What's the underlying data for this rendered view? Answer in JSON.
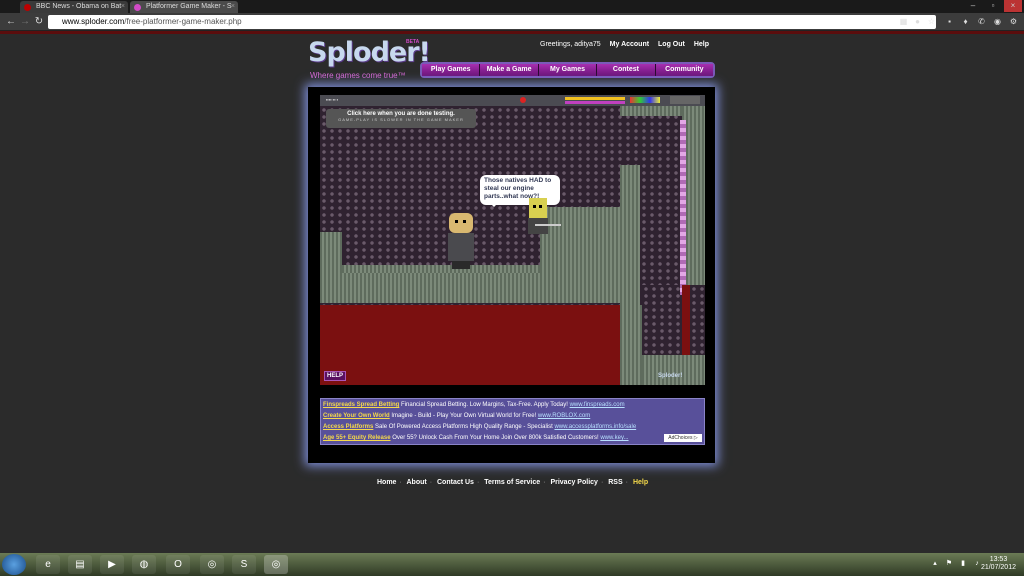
{
  "browser": {
    "tabs": [
      {
        "label": "BBC News - Obama on Bat",
        "active": false
      },
      {
        "label": "Platformer Game Maker - S",
        "active": true
      }
    ],
    "url_host": "www.sploder.com",
    "url_path": "/free-platformer-game-maker.php"
  },
  "header": {
    "logo": "Sploder!",
    "beta": "BETA",
    "tagline": "Where games come true™",
    "greeting": "Greetings, aditya75",
    "links": [
      "My Account",
      "Log Out",
      "Help"
    ]
  },
  "nav": [
    "Play Games",
    "Make a Game",
    "My Games",
    "Contest",
    "Community"
  ],
  "game": {
    "test_title": "Click here when you are done testing.",
    "test_sub": "GAME-PLAY IS SLOWER IN THE GAME MAKER",
    "speech": "Those natives HAD to steal our engine parts..what now?!",
    "help": "HELP",
    "badge": "Sploder!"
  },
  "ads": [
    {
      "title": "Finspreads Spread Betting",
      "text": "Financial Spread Betting. Low Margins, Tax-Free. Apply Today!",
      "url": "www.finspreads.com"
    },
    {
      "title": "Create Your Own World",
      "text": "Imagine - Build - Play Your Own Virtual World for Free!",
      "url": "www.ROBLOX.com"
    },
    {
      "title": "Access Platforms",
      "text": "Sale Of Powered Access Platforms High Quality Range - Specialist",
      "url": "www.accessplatforms.info/sale"
    },
    {
      "title": "Age 55+ Equity Release",
      "text": "Over 55? Unlock Cash From Your Home Join Over 800k Satisfied Customers!",
      "url": "www.key..."
    }
  ],
  "adchoices": "AdChoices ▷",
  "footer": [
    "Home",
    "About",
    "Contact Us",
    "Terms of Service",
    "Privacy Policy",
    "RSS",
    "Help"
  ],
  "taskbar": {
    "time": "13:53",
    "date": "21/07/2012"
  },
  "colors": {
    "accent": "#a82fb0",
    "page_bg": "#2b2b2b",
    "frame_glow": "#7e8ed8",
    "lava": "#7b1010"
  }
}
